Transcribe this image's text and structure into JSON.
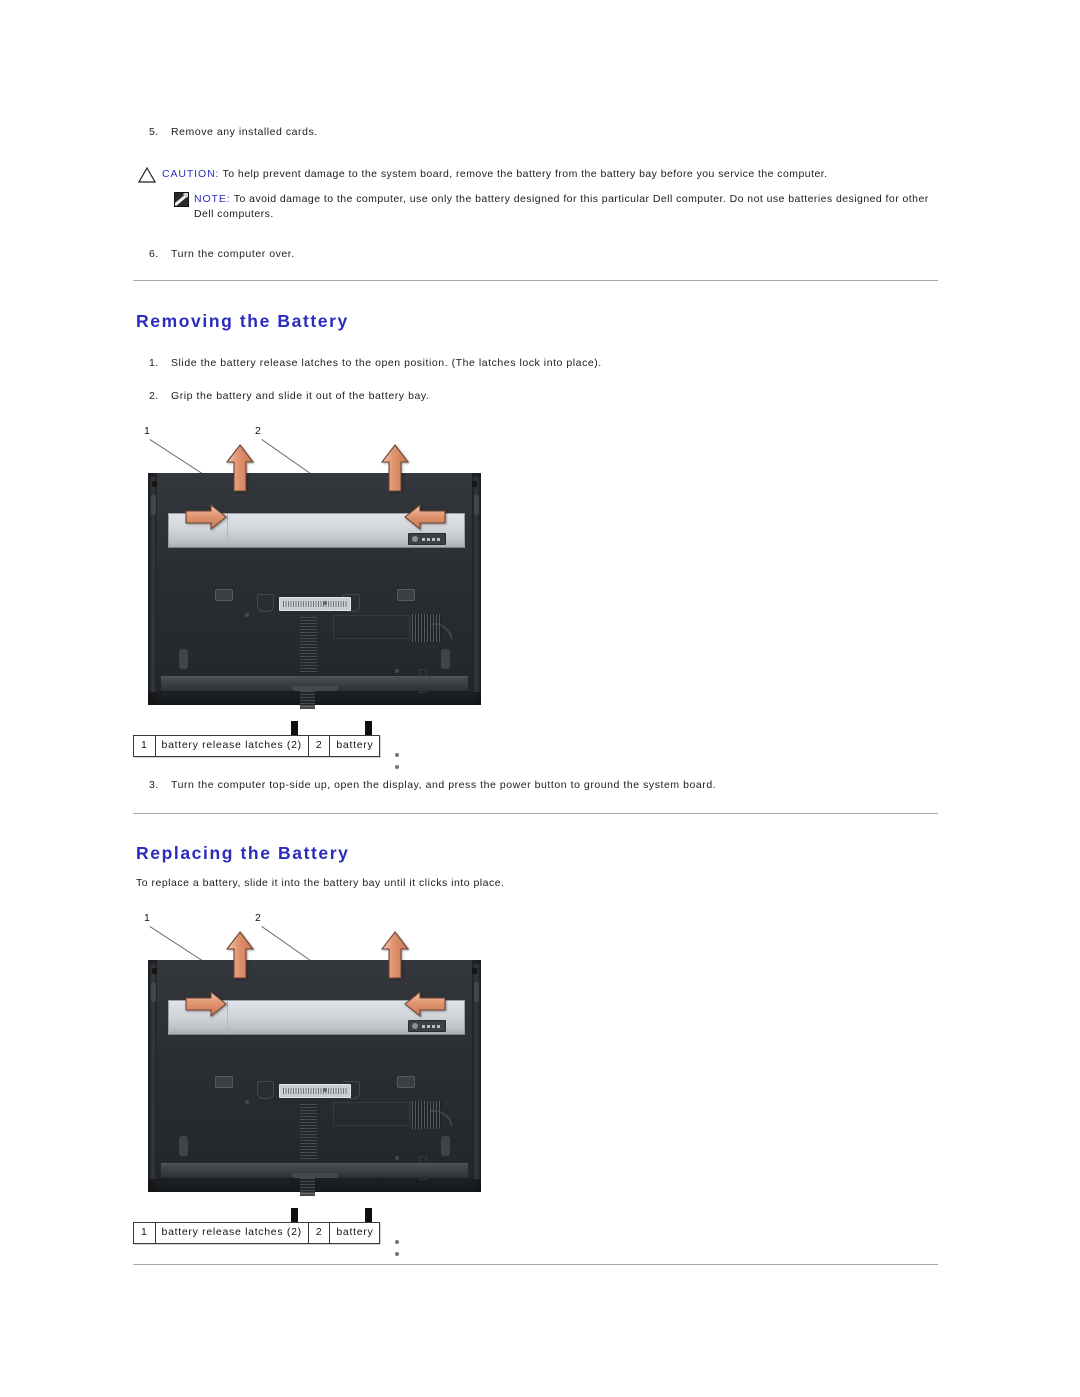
{
  "document": {
    "steps_before": [
      {
        "num": "5.",
        "text": "Remove any installed cards."
      }
    ],
    "caution": {
      "label": "CAUTION:",
      "text": " To help prevent damage to the system board, remove the battery from the battery bay before you service the computer.",
      "icon": "warning-triangle-icon"
    },
    "note": {
      "label": "NOTE:",
      "text": " To avoid damage to the computer, use only the battery designed for this particular Dell computer. Do not use batteries designed for other Dell computers.",
      "icon": "note-pencil-icon"
    },
    "steps_after": [
      {
        "num": "6.",
        "text": "Turn the computer over."
      }
    ],
    "sections": [
      {
        "heading": "Removing the Battery",
        "steps": [
          {
            "num": "1.",
            "text": "Slide the battery release latches to the open position. (The latches lock into place)."
          },
          {
            "num": "2.",
            "text": "Grip the battery and slide it out of the battery bay."
          }
        ],
        "figure": {
          "callouts": [
            {
              "num": "1",
              "target": "battery release latches"
            },
            {
              "num": "2",
              "target": "battery"
            }
          ],
          "alt": "Bottom view of laptop showing battery and release latches"
        },
        "legend": [
          {
            "num": "1",
            "label": "battery release latches (2)"
          },
          {
            "num": "2",
            "label": "battery"
          }
        ],
        "steps_trailing": [
          {
            "num": "3.",
            "text": "Turn the computer top-side up, open the display, and press the power button to ground the system board."
          }
        ]
      },
      {
        "heading": "Replacing the Battery",
        "intro": "To replace a battery, slide it into the battery bay until it clicks into place.",
        "figure": {
          "callouts": [
            {
              "num": "1",
              "target": "battery release latches"
            },
            {
              "num": "2",
              "target": "battery"
            }
          ],
          "alt": "Bottom view of laptop showing battery and release latches"
        },
        "legend": [
          {
            "num": "1",
            "label": "battery release latches (2)"
          },
          {
            "num": "2",
            "label": "battery"
          }
        ]
      }
    ],
    "colors": {
      "heading": "#2b2bbf",
      "admonition_label": "#2b2bbf",
      "rule": "#a9a9a9",
      "arrow": "#e0926d",
      "body_text": "#1c1c1c"
    }
  }
}
